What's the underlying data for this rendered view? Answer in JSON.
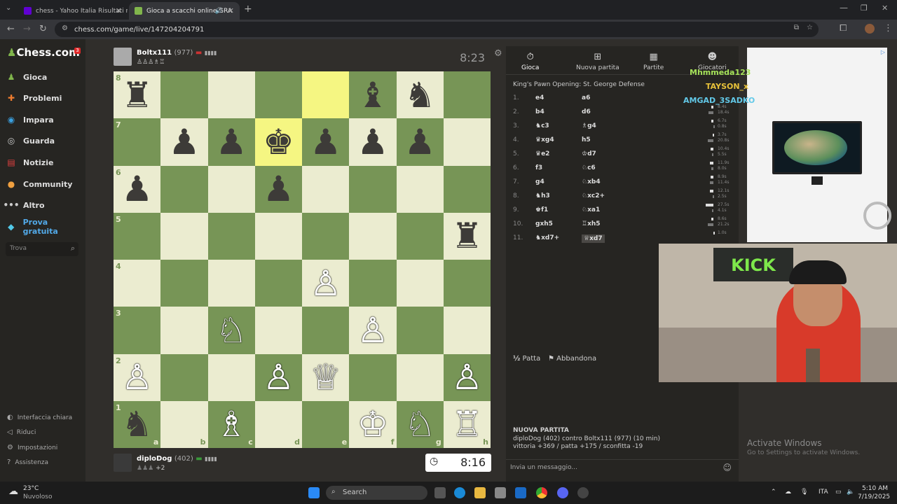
{
  "browser": {
    "tabs": [
      {
        "title": "chess - Yahoo Italia Risultati ric",
        "active": false
      },
      {
        "title": "Gioca a scacchi online GRA",
        "active": true
      }
    ],
    "url": "chess.com/game/live/147204204791"
  },
  "sidebar": {
    "logo": "Chess.com",
    "notif": "3",
    "items": [
      {
        "label": "Gioca",
        "icon": "play-icon"
      },
      {
        "label": "Problemi",
        "icon": "puzzle-icon"
      },
      {
        "label": "Impara",
        "icon": "learn-icon"
      },
      {
        "label": "Guarda",
        "icon": "binoculars-icon"
      },
      {
        "label": "Notizie",
        "icon": "news-icon"
      },
      {
        "label": "Community",
        "icon": "community-icon"
      },
      {
        "label": "Altro",
        "icon": "more-icon"
      },
      {
        "label": "Prova gratuita",
        "icon": "diamond-icon"
      }
    ],
    "search_placeholder": "Trova",
    "bottom": [
      {
        "label": "Interfaccia chiara",
        "icon": "theme-icon"
      },
      {
        "label": "Riduci",
        "icon": "collapse-icon"
      },
      {
        "label": "Impostazioni",
        "icon": "settings-icon"
      },
      {
        "label": "Assistenza",
        "icon": "help-icon"
      }
    ]
  },
  "top_player": {
    "name": "Boltx111",
    "rating": "(977)",
    "clock": "8:23"
  },
  "bottom_player": {
    "name": "diploDog",
    "rating": "(402)",
    "captured_extra": "+2",
    "clock": "8:16"
  },
  "board": {
    "ranks": [
      "8",
      "7",
      "6",
      "5",
      "4",
      "3",
      "2",
      "1"
    ],
    "files": [
      "a",
      "b",
      "c",
      "d",
      "e",
      "f",
      "g",
      "h"
    ],
    "highlight": [
      "e8",
      "d7"
    ],
    "pieces": [
      {
        "sq": "a8",
        "p": "♜",
        "c": "b"
      },
      {
        "sq": "f8",
        "p": "♝",
        "c": "b"
      },
      {
        "sq": "g8",
        "p": "♞",
        "c": "b"
      },
      {
        "sq": "b7",
        "p": "♟",
        "c": "b"
      },
      {
        "sq": "c7",
        "p": "♟",
        "c": "b"
      },
      {
        "sq": "d7",
        "p": "♚",
        "c": "b"
      },
      {
        "sq": "e7",
        "p": "♟",
        "c": "b"
      },
      {
        "sq": "f7",
        "p": "♟",
        "c": "b"
      },
      {
        "sq": "g7",
        "p": "♟",
        "c": "b"
      },
      {
        "sq": "a6",
        "p": "♟",
        "c": "b"
      },
      {
        "sq": "d6",
        "p": "♟",
        "c": "b"
      },
      {
        "sq": "h5",
        "p": "♜",
        "c": "b"
      },
      {
        "sq": "e4",
        "p": "♙",
        "c": "w"
      },
      {
        "sq": "c3",
        "p": "♘",
        "c": "w"
      },
      {
        "sq": "f3",
        "p": "♙",
        "c": "w"
      },
      {
        "sq": "a2",
        "p": "♙",
        "c": "w"
      },
      {
        "sq": "d2",
        "p": "♙",
        "c": "w"
      },
      {
        "sq": "e2",
        "p": "♕",
        "c": "w"
      },
      {
        "sq": "h2",
        "p": "♙",
        "c": "w"
      },
      {
        "sq": "a1",
        "p": "♞",
        "c": "b"
      },
      {
        "sq": "c1",
        "p": "♗",
        "c": "w"
      },
      {
        "sq": "f1",
        "p": "♔",
        "c": "w"
      },
      {
        "sq": "g1",
        "p": "♘",
        "c": "w"
      },
      {
        "sq": "h1",
        "p": "♖",
        "c": "w"
      }
    ]
  },
  "panel": {
    "tabs": [
      "Gioca",
      "Nuova partita",
      "Partite",
      "Giocatori"
    ],
    "opening": "King's Pawn Opening: St. George Defense",
    "moves": [
      {
        "n": "1.",
        "w": "e4",
        "b": "a6"
      },
      {
        "n": "2.",
        "w": "b4",
        "b": "d6"
      },
      {
        "n": "3.",
        "w": "♞c3",
        "b": "♗g4"
      },
      {
        "n": "4.",
        "w": "♛xg4",
        "b": "h5"
      },
      {
        "n": "5.",
        "w": "♛e2",
        "b": "♔d7"
      },
      {
        "n": "6.",
        "w": "f3",
        "b": "♘c6"
      },
      {
        "n": "7.",
        "w": "g4",
        "b": "♘xb4"
      },
      {
        "n": "8.",
        "w": "♞h3",
        "b": "♘xc2+"
      },
      {
        "n": "9.",
        "w": "♚f1",
        "b": "♘xa1"
      },
      {
        "n": "10.",
        "w": "gxh5",
        "b": "♖xh5"
      },
      {
        "n": "11.",
        "w": "♞xd7+",
        "b": "♕xd7"
      }
    ],
    "times": [
      [
        "8.4s",
        "18.4s"
      ],
      [
        "6.7s",
        "0.8s"
      ],
      [
        "3.7s",
        "20.8s"
      ],
      [
        "10.4s",
        "5.5s"
      ],
      [
        "11.9s",
        "8.0s"
      ],
      [
        "8.9s",
        "11.4s"
      ],
      [
        "12.1s",
        "2.5s"
      ],
      [
        "27.5s",
        "4.1s"
      ],
      [
        "8.6s",
        "21.2s"
      ],
      [
        "1.0s",
        ""
      ]
    ],
    "draw": "Patta",
    "resign": "Abbandona",
    "new_game": {
      "heading": "NUOVA PARTITA",
      "line1": "diploDog (402) contro Boltx111 (977) (10 min)",
      "line2": "vittoria +369 / patta +175 / sconfitta -19"
    },
    "chat_placeholder": "Invia un messaggio..."
  },
  "stream_chat": [
    {
      "user": "Mhmmeda123",
      "color": "#a6e35a"
    },
    {
      "user": "TAYSON_x",
      "color": "#e8c23a"
    },
    {
      "user": "AMGAD_3SADKO",
      "color": "#62c9e8"
    }
  ],
  "webcam": {
    "sign": "KICK"
  },
  "watermark": {
    "line1": "Activate Windows",
    "line2": "Go to Settings to activate Windows."
  },
  "taskbar": {
    "weather_temp": "23°C",
    "weather_desc": "Nuvoloso",
    "search": "Search",
    "lang": "ITA",
    "time": "5:10 AM",
    "date": "7/19/2025"
  }
}
